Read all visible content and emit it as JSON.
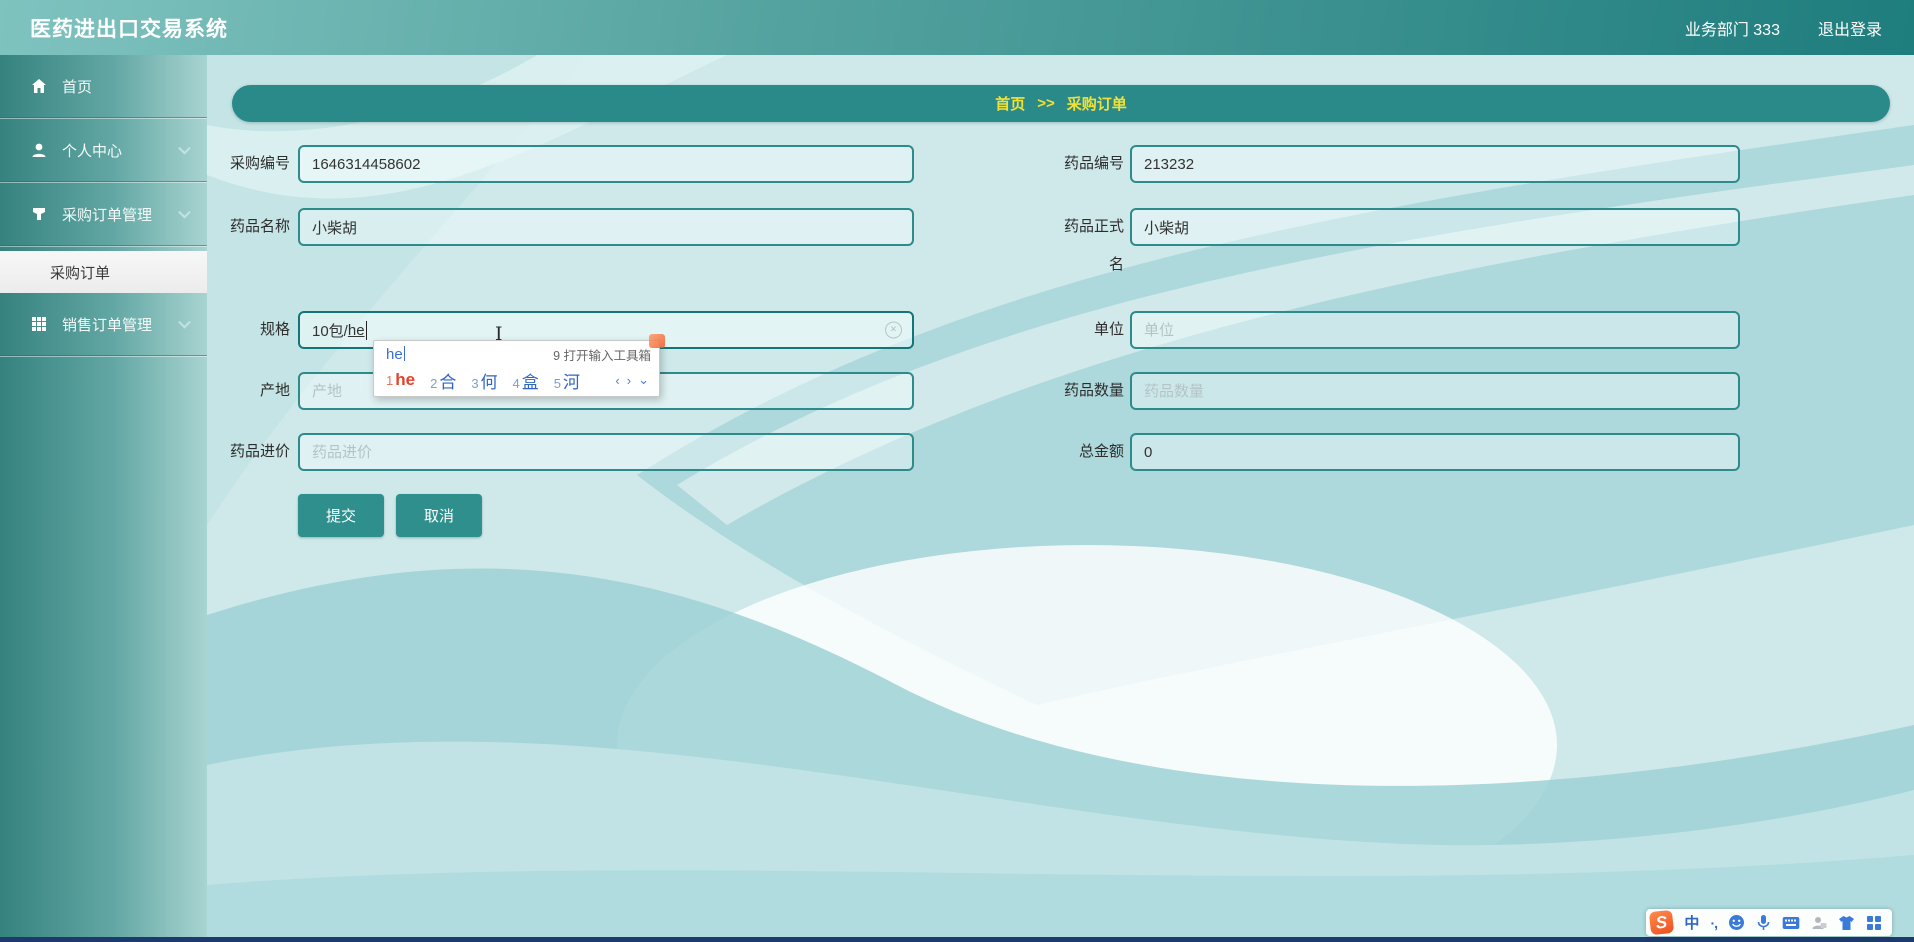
{
  "colors": {
    "accent_teal": "#2e8b8b",
    "header_teal_dark": "#1e7d7d",
    "breadcrumb_bg": "#2a8a8a",
    "breadcrumb_text": "#f2e135",
    "button_bg": "#2e8f8d",
    "ime_candidate_blue": "#2f66c4",
    "ime_selected_red": "#e0442c",
    "sogou_orange": "#ee4f1e"
  },
  "header": {
    "title": "医药进出口交易系统",
    "user": "业务部门 333",
    "logout": "退出登录"
  },
  "sidebar": {
    "items": [
      {
        "label": "首页",
        "icon": "home-icon"
      },
      {
        "label": "个人中心",
        "icon": "user-icon",
        "expandable": true
      },
      {
        "label": "采购订单管理",
        "icon": "funnel-icon",
        "expandable": true
      },
      {
        "label": "采购订单",
        "submenu": true,
        "active": true
      },
      {
        "label": "销售订单管理",
        "icon": "grid-icon",
        "expandable": true
      }
    ]
  },
  "breadcrumb": {
    "home": "首页",
    "separator": ">>",
    "current": "采购订单"
  },
  "form": {
    "fields": {
      "purchase_no": {
        "label": "采购编号",
        "value": "1646314458602"
      },
      "drug_no": {
        "label": "药品编号",
        "value": "213232"
      },
      "drug_name": {
        "label": "药品名称",
        "value": "小柴胡"
      },
      "official_name": {
        "label": "药品正式名",
        "value": "小柴胡"
      },
      "spec": {
        "label": "规格",
        "value": "10包/",
        "composing": "he"
      },
      "unit": {
        "label": "单位",
        "placeholder": "单位"
      },
      "origin": {
        "label": "产地",
        "placeholder": "产地"
      },
      "quantity": {
        "label": "药品数量",
        "placeholder": "药品数量"
      },
      "price": {
        "label": "药品进价",
        "placeholder": "药品进价"
      },
      "total": {
        "label": "总金额",
        "value": "0"
      }
    },
    "submit_label": "提交",
    "cancel_label": "取消"
  },
  "ime": {
    "composition": "he",
    "toolbox_hint": "9 打开输入工具箱",
    "candidates": [
      {
        "index": "1",
        "text": "he"
      },
      {
        "index": "2",
        "text": "合"
      },
      {
        "index": "3",
        "text": "何"
      },
      {
        "index": "4",
        "text": "盒"
      },
      {
        "index": "5",
        "text": "河"
      }
    ],
    "prev_arrow": "‹",
    "next_arrow": "›",
    "more_arrow": "⌄"
  },
  "taskbar": {
    "sogou_logo": "S",
    "chinese_mode": "中",
    "punctuation": "·,",
    "icons": [
      "emoji-icon",
      "microphone-icon",
      "keyboard-icon",
      "account-icon",
      "skin-icon",
      "more-grid-icon"
    ]
  }
}
